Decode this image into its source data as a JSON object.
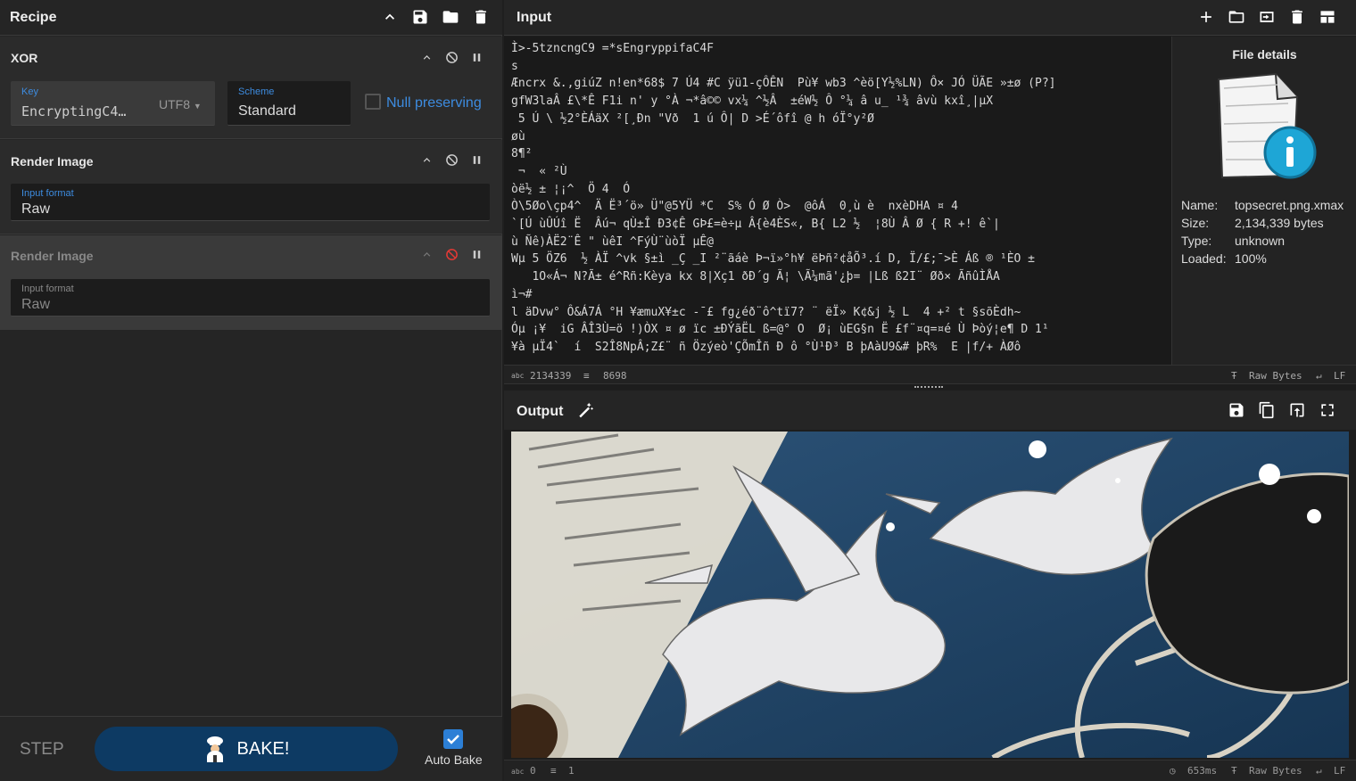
{
  "recipe": {
    "title": "Recipe",
    "icons": [
      "chevron-up-icon",
      "save-icon",
      "folder-icon",
      "trash-icon"
    ],
    "ops": [
      {
        "name": "XOR",
        "key_label": "Key",
        "key_value": "EncryptingC4…",
        "key_encoding": "UTF8",
        "scheme_label": "Scheme",
        "scheme_value": "Standard",
        "null_label": "Null preserving"
      },
      {
        "name": "Render Image",
        "format_label": "Input format",
        "format_value": "Raw"
      },
      {
        "name": "Render Image",
        "format_label": "Input format",
        "format_value": "Raw",
        "disabled": true
      }
    ],
    "footer": {
      "step": "STEP",
      "bake": "BAKE!",
      "auto_bake": "Auto Bake",
      "auto_bake_checked": true
    }
  },
  "input": {
    "title": "Input",
    "text_lines": [
      "Ì>-5tzncngC9 =*sEngryppifaC4F",
      "s",
      "Æncrx &.,giúZ n!en*68$ 7 Ú4 #C ÿü1-çÔÊN  Pù¥ wb3 ^èö[Y½%LN) Ô× JÓ ÜÃE »±ø (P?]",
      "gfW3laÂ £\\*Ê F1i n' y °À ¬*â©© vx¼ ^½Â  ±éW½ Ô °¼ â u_ ¹¾ âvù kxî¸|µX",
      " 5 Ú \\ ½2°ÈÁäX ²[¸Ðn \"Vð  1 ú Ô| D >É´ôfî @ h óÏ°y²Ø",
      "øù",
      "8¶²",
      " ¬  « ²Ù",
      "òë½ ± ¦¡^  Ö 4  Ó",
      "Ò\\5Øo\\çp4^  Ä Ë³´ö» Ü\"@5YÜ *C  S% Ó Ø Ò>  @ôÁ  0¸ù è  nxèDHA ¤ 4",
      "`[Ú ùÛÚî Ë  Âú¬ qÙ±Î Ð3¢Ê GÞ£=è÷µ Â{è4ÈS«, B{ L2 ½  ¦8Ù Â Ø { R +! ê`|",
      "ù Ñê)ÀË2¨Ê \" ùêI ^FýÙ¨ùòÏ µÊ@",
      "Wµ 5 ÖZ6  ½ ÀÏ ^vk §±ì _Ç _I ²¨ãáè Þ¬ï»°h¥ ëÞñ²¢åÕ³.í D, Ï/£;¯>È Áß ® ¹ÈO ±",
      "   1O«Á¬ N?Ã± é^Rñ:Kèya kx 8|Xç1 ðÐ´g Ã¦ \\Ã¼mã'¿þ= |Lß ß2I¨ Øð× ÃñûÌÅA",
      "ì¬#",
      "l äDvw° Ô&Á7Á °H ¥æmuX¥±c -¯£ fg¿éð¨ô^tï7? ¨ ëÏ» K¢&j ½ L  4 +² t §sõÈdh~",
      "Óµ ¡¥  iG ÂÎ3Ù=ö !)ÒX ¤ ø ïc ±ÐÝãËL ß=@° O  Ø¡ ùEG§n Ë £f¨¤q=¤é Ù Þòý¦e¶ D 1¹",
      "¥à µÏ4`  í  S2Î8NpÂ;Z£¨ ñ Özýeò'ÇÕmÎñ Ð ô °Ù¹Ð³ B þAàU9&# þR%  E |f/+ ÀØô"
    ],
    "status": {
      "length": "2134339",
      "lines": "8698",
      "mode": "Raw Bytes",
      "eol": "LF"
    },
    "file_details": {
      "title": "File details",
      "name_label": "Name:",
      "name": "topsecret.png.xmax",
      "size_label": "Size:",
      "size": "2,134,339 bytes",
      "type_label": "Type:",
      "type": "unknown",
      "loaded_label": "Loaded:",
      "loaded": "100%"
    }
  },
  "output": {
    "title": "Output",
    "status": {
      "length": "0",
      "lines": "1",
      "time": "653ms",
      "mode": "Raw Bytes",
      "eol": "LF"
    }
  }
}
